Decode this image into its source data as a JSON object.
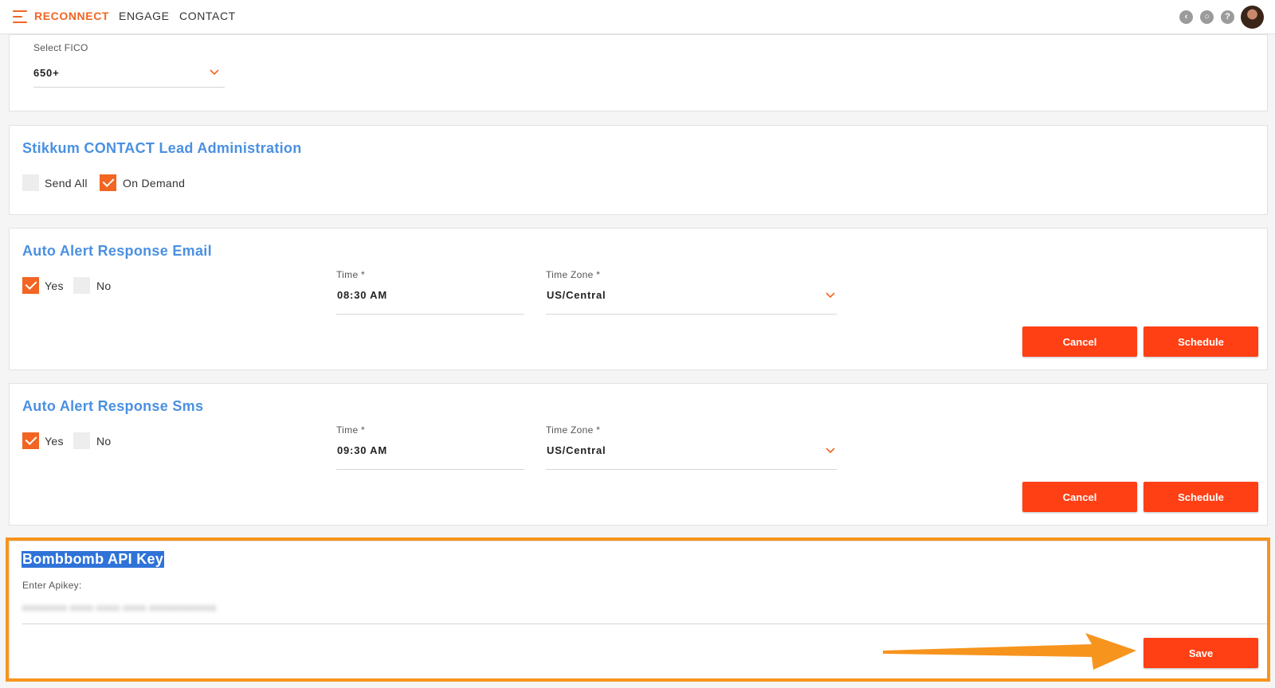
{
  "header": {
    "nav": [
      "RECONNECT",
      "ENGAGE",
      "CONTACT"
    ],
    "icons": [
      "back-icon",
      "support-icon",
      "help-icon"
    ],
    "accent_color": "#f26522"
  },
  "fico": {
    "label": "Select FICO",
    "value": "650+"
  },
  "lead_admin": {
    "title": "Stikkum CONTACT Lead Administration",
    "options": [
      {
        "label": "Send All",
        "checked": false
      },
      {
        "label": "On Demand",
        "checked": true
      }
    ]
  },
  "alert_email": {
    "title": "Auto Alert Response Email",
    "yes_label": "Yes",
    "no_label": "No",
    "yes_checked": true,
    "no_checked": false,
    "time_label": "Time *",
    "time_value": "08:30 AM",
    "tz_label": "Time Zone *",
    "tz_value": "US/Central",
    "cancel_label": "Cancel",
    "schedule_label": "Schedule"
  },
  "alert_sms": {
    "title": "Auto Alert Response Sms",
    "yes_label": "Yes",
    "no_label": "No",
    "yes_checked": true,
    "no_checked": false,
    "time_label": "Time *",
    "time_value": "09:30 AM",
    "tz_label": "Time Zone *",
    "tz_value": "US/Central",
    "cancel_label": "Cancel",
    "schedule_label": "Schedule"
  },
  "bombbomb": {
    "title": "Bombbomb API Key",
    "field_label": "Enter Apikey:",
    "api_key_masked": "xxxxxxxx-xxxx-xxxx-xxxx-xxxxxxxxxxxx",
    "save_label": "Save"
  },
  "colors": {
    "title_blue": "#4a90e2",
    "button_red": "#ff3f14",
    "highlight_orange": "#f7941d"
  }
}
